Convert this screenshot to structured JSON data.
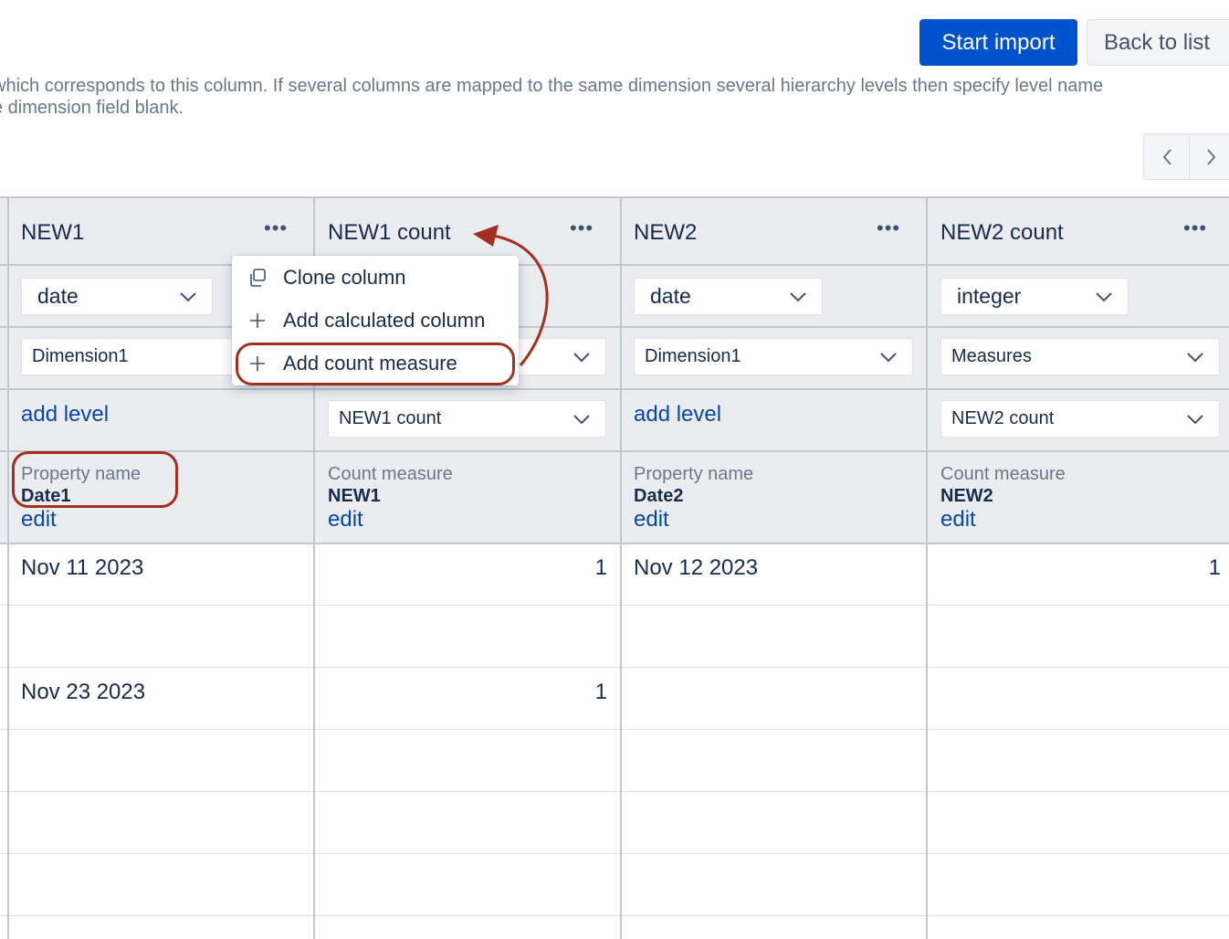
{
  "toolbar": {
    "start_import_label": "Start import",
    "back_to_list_label": "Back to list"
  },
  "help_text": {
    "line1": " which corresponds to this column. If several columns are mapped to the same dimension several hierarchy levels then specify level name",
    "line2": "e dimension field blank."
  },
  "pager": {
    "prev_icon": "chevron-left-icon",
    "next_icon": "chevron-right-icon"
  },
  "columns": [
    {
      "title": "NEW1",
      "type": "date",
      "dimension": "Dimension1",
      "level_link": "add level",
      "meta_label": "Property name",
      "meta_value": "Date1",
      "edit_label": "edit",
      "rows": [
        "Nov 11 2023",
        "",
        "Nov 23 2023",
        "",
        "",
        "",
        ""
      ]
    },
    {
      "title": "NEW1 count",
      "type": "",
      "dimension": "",
      "level": "NEW1 count",
      "meta_label": "Count measure",
      "meta_value": "NEW1",
      "edit_label": "edit",
      "rows": [
        "1",
        "",
        "1",
        "",
        "",
        "",
        ""
      ]
    },
    {
      "title": "NEW2",
      "type": "date",
      "dimension": "Dimension1",
      "level_link": "add level",
      "meta_label": "Property name",
      "meta_value": "Date2",
      "edit_label": "edit",
      "rows": [
        "Nov 12 2023",
        "",
        "",
        "",
        "",
        "",
        ""
      ]
    },
    {
      "title": "NEW2 count",
      "type": "integer",
      "dimension": "Measures",
      "level": "NEW2 count",
      "meta_label": "Count measure",
      "meta_value": "NEW2",
      "edit_label": "edit",
      "rows": [
        "1",
        "",
        "",
        "",
        "",
        "",
        ""
      ]
    }
  ],
  "column_menu": {
    "items": [
      {
        "label": "Clone column",
        "icon": "clone-icon"
      },
      {
        "label": "Add calculated column",
        "icon": "plus-icon"
      },
      {
        "label": "Add count measure",
        "icon": "plus-icon"
      }
    ]
  },
  "column_menu_icon": "more-options-icon",
  "colors": {
    "primary": "#0052cc",
    "link": "#0747a6",
    "header_bg": "#ebecf0",
    "annotation": "#a32f1e"
  }
}
